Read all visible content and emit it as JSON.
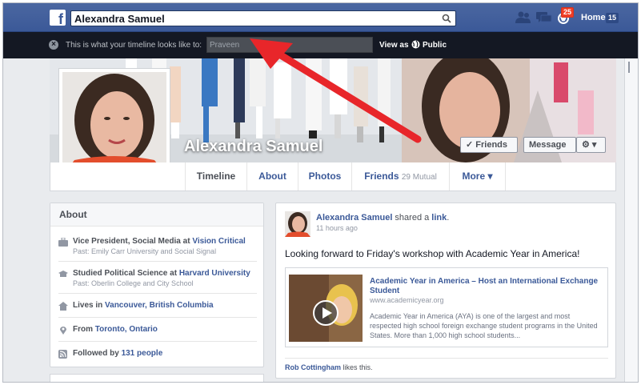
{
  "topbar": {
    "logo": "f",
    "search_value": "Alexandra Samuel",
    "notifications_count": "25",
    "home_label": "Home",
    "home_count": "15",
    "icons": [
      "friend-requests-icon",
      "messages-icon",
      "notifications-icon",
      "search-icon"
    ]
  },
  "viewas": {
    "close": "×",
    "message": "This is what your timeline looks like to:",
    "input_value": "Praveen",
    "view_as_label": "View as",
    "public_label": "Public"
  },
  "profile": {
    "name": "Alexandra Samuel",
    "friends_button": "✓ Friends",
    "message_button": "Message",
    "settings_button": "⚙ ▾"
  },
  "tabs": {
    "timeline": "Timeline",
    "about": "About",
    "photos": "Photos",
    "friends": "Friends",
    "friends_mutual": "29 Mutual",
    "more": "More ▾"
  },
  "about": {
    "header": "About",
    "work_title": "Vice President, Social Media at ",
    "work_company": "Vision Critical",
    "work_past": "Past: Emily Carr University and Social Signal",
    "edu_title": "Studied Political Science at ",
    "edu_school": "Harvard University",
    "edu_past": "Past: Oberlin College and City School",
    "lives_prefix": "Lives in ",
    "lives_place": "Vancouver, British Columbia",
    "from_prefix": "From ",
    "from_place": "Toronto, Ontario",
    "followed_prefix": "Followed by ",
    "followed_count": "131 people"
  },
  "post": {
    "author": "Alexandra Samuel",
    "action": " shared a ",
    "object": "link",
    "after": ".",
    "time": "11 hours ago",
    "text": "Looking forward to Friday's workshop with Academic Year in America!",
    "link_title": "Academic Year in America – Host an International Exchange Student",
    "link_domain": "www.academicyear.org",
    "link_desc": "Academic Year in America (AYA) is one of the largest and most respected high school foreign exchange student programs in the United States. More than 1,000 high school students...",
    "liker": "Rob Cottingham",
    "likes_suffix": " likes this."
  },
  "colors": {
    "facebook_blue": "#3b5998",
    "banner_dark": "#141823",
    "arrow_red": "#e8262a",
    "badge_red": "#f03d25"
  }
}
